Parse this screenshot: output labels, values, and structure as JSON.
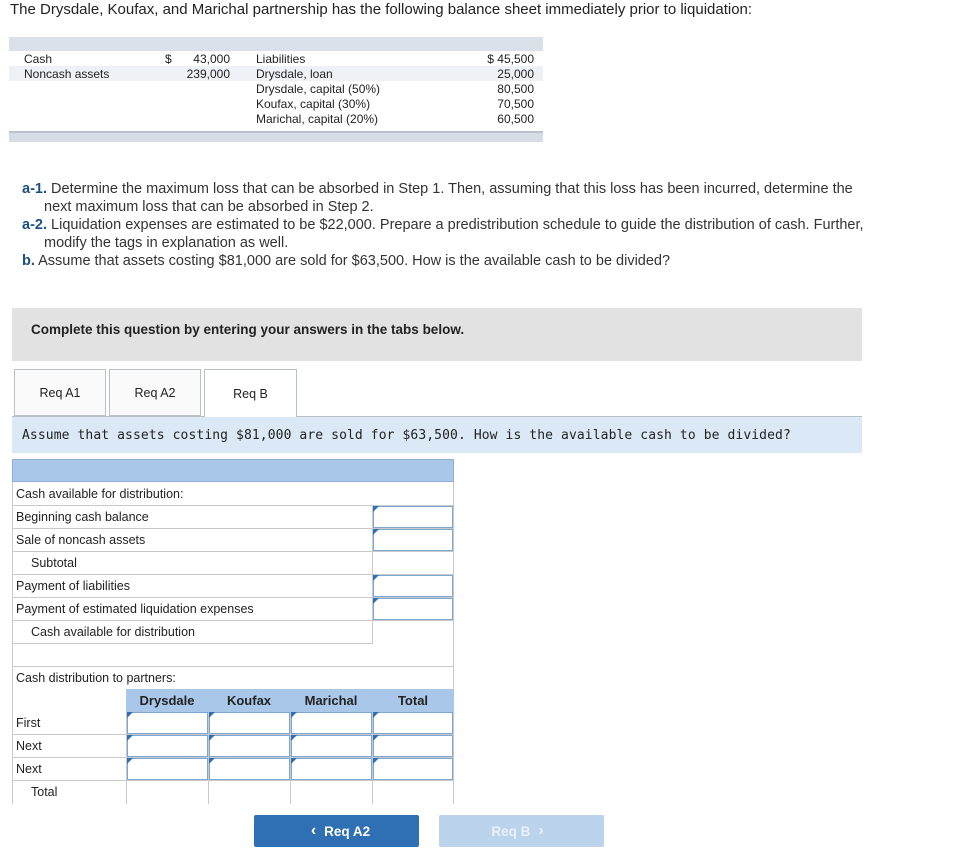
{
  "intro": "The Drysdale, Koufax, and Marichal partnership has the following balance sheet immediately prior to liquidation:",
  "balance_sheet": {
    "assets": [
      {
        "label": "Cash",
        "prefix": "$",
        "value": "43,000"
      },
      {
        "label": "Noncash assets",
        "prefix": "",
        "value": "239,000"
      }
    ],
    "liabilities": [
      {
        "label": "Liabilities",
        "value": "$ 45,500"
      },
      {
        "label": "Drysdale, loan",
        "value": "25,000"
      },
      {
        "label": "Drysdale, capital (50%)",
        "value": "80,500"
      },
      {
        "label": "Koufax, capital (30%)",
        "value": "70,500"
      },
      {
        "label": "Marichal, capital (20%)",
        "value": "60,500"
      }
    ]
  },
  "questions": {
    "a1_tag": "a-1.",
    "a1_line1": "Determine the maximum loss that can be absorbed in Step 1. Then, assuming that this loss has been incurred, determine the",
    "a1_line2": "next maximum loss that can be absorbed in Step 2.",
    "a2_tag": "a-2.",
    "a2_line1": "Liquidation expenses are estimated to be $22,000. Prepare a predistribution schedule to guide the distribution of cash. Further,",
    "a2_line2": "modify the tags in explanation as well.",
    "b_tag": "b.",
    "b_line1": "Assume that assets costing $81,000 are sold for $63,500. How is the available cash to be divided?"
  },
  "instruction": "Complete this question by entering your answers in the tabs below.",
  "tabs": [
    {
      "label": "Req A1",
      "active": false
    },
    {
      "label": "Req A2",
      "active": false
    },
    {
      "label": "Req B",
      "active": true
    }
  ],
  "req_prompt": "Assume that assets costing $81,000 are sold for $63,500. How is the available cash to be divided?",
  "table": {
    "section1_title": "Cash available for distribution:",
    "rows": [
      {
        "label": "Beginning cash balance",
        "value": ""
      },
      {
        "label": "Sale of noncash assets",
        "value": ""
      },
      {
        "label": "Subtotal",
        "value": ""
      },
      {
        "label": "Payment of liabilities",
        "value": ""
      },
      {
        "label": "Payment of estimated liquidation expenses",
        "value": ""
      },
      {
        "label": "Cash available for distribution",
        "value": ""
      }
    ],
    "section2_title": "Cash distribution to partners:",
    "columns": [
      "Drysdale",
      "Koufax",
      "Marichal",
      "Total"
    ],
    "dist_rows": [
      {
        "label": "First",
        "values": [
          "",
          "",
          "",
          ""
        ]
      },
      {
        "label": "Next",
        "values": [
          "",
          "",
          "",
          ""
        ]
      },
      {
        "label": "Next",
        "values": [
          "",
          "",
          "",
          ""
        ]
      },
      {
        "label": "Total",
        "values": [
          "",
          "",
          "",
          ""
        ]
      }
    ]
  },
  "nav": {
    "prev_label": "Req A2",
    "next_label": "Req B"
  },
  "colors": {
    "accent": "#2f6fb3",
    "header_blue": "#a9c7e8",
    "prompt_strip": "#dbe9f6"
  }
}
